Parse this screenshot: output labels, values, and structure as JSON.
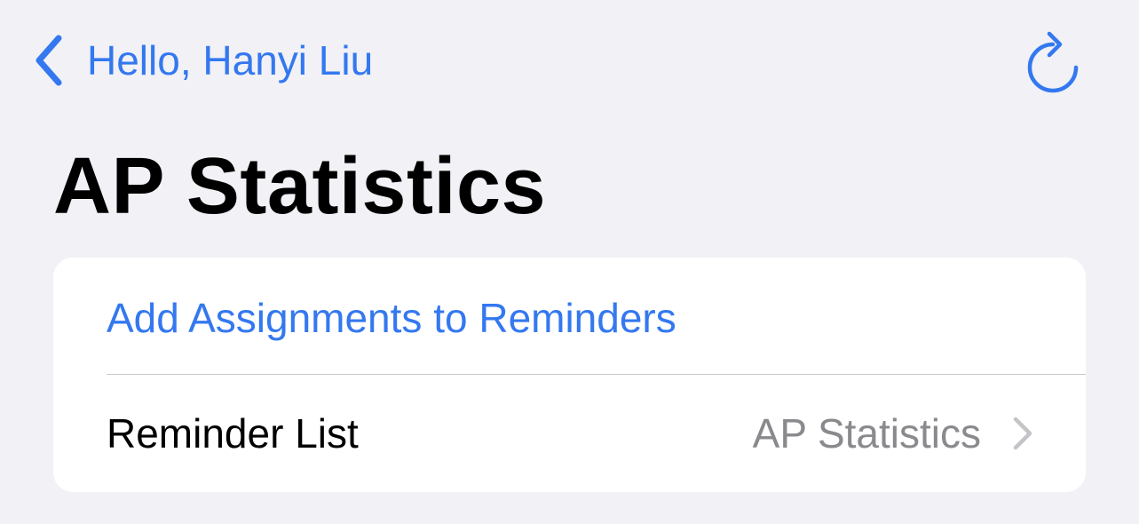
{
  "nav": {
    "back_label": "Hello, Hanyi Liu",
    "back_icon": "chevron-left-icon",
    "refresh_icon": "arrow-clockwise-icon"
  },
  "page": {
    "title": "AP Statistics"
  },
  "settings": {
    "add_assignments_label": "Add Assignments to Reminders",
    "reminder_list_label": "Reminder List",
    "reminder_list_value": "AP Statistics"
  },
  "colors": {
    "accent": "#3478f0",
    "background": "#f1f1f6",
    "card": "#ffffff",
    "secondary_text": "#8a8a8e"
  }
}
